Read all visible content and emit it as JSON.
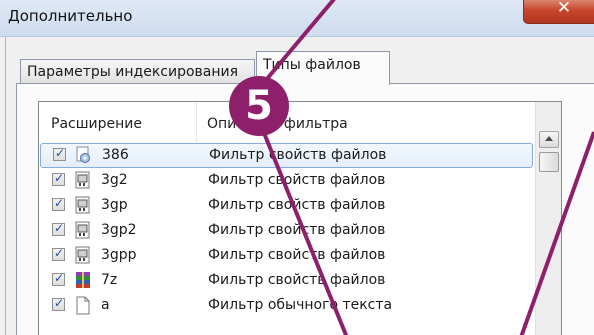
{
  "window": {
    "title": "Дополнительно",
    "close_glyph": "✕"
  },
  "tabs": [
    {
      "label": "Параметры индексирования",
      "active": false
    },
    {
      "label": "Типы файлов",
      "active": true
    }
  ],
  "list": {
    "columns": [
      "Расширение",
      "Описание фильтра"
    ],
    "rows": [
      {
        "checked": true,
        "icon": "settings-file-icon",
        "ext": "386",
        "desc": "Фильтр свойств файлов",
        "selected": true
      },
      {
        "checked": true,
        "icon": "media-file-icon",
        "ext": "3g2",
        "desc": "Фильтр свойств файлов"
      },
      {
        "checked": true,
        "icon": "media-file-icon",
        "ext": "3gp",
        "desc": "Фильтр свойств файлов"
      },
      {
        "checked": true,
        "icon": "media-file-icon",
        "ext": "3gp2",
        "desc": "Фильтр свойств файлов"
      },
      {
        "checked": true,
        "icon": "media-file-icon",
        "ext": "3gpp",
        "desc": "Фильтр свойств файлов"
      },
      {
        "checked": true,
        "icon": "archive-file-icon",
        "ext": "7z",
        "desc": "Фильтр свойств файлов"
      },
      {
        "checked": true,
        "icon": "blank-file-icon",
        "ext": "a",
        "desc": "Фильтр обычного текста"
      }
    ]
  },
  "annotation": {
    "step": "5",
    "color": "#8e1f6b"
  }
}
